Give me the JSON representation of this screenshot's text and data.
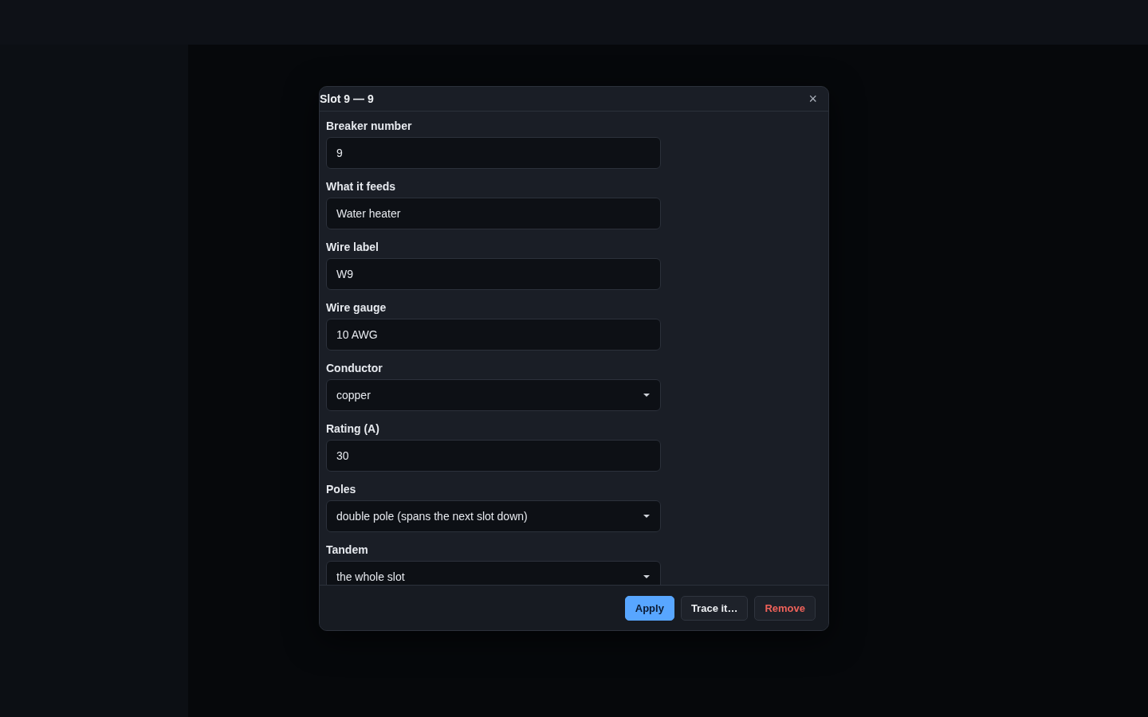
{
  "dialog": {
    "title": "Slot 9 — 9",
    "close": "×",
    "fields": [
      {
        "label": "Breaker number",
        "kind": "text",
        "value": "9"
      },
      {
        "label": "What it feeds",
        "kind": "text",
        "value": "Water heater"
      },
      {
        "label": "Wire label",
        "kind": "text",
        "value": "W9"
      },
      {
        "label": "Wire gauge",
        "kind": "text",
        "value": "10 AWG"
      },
      {
        "label": "Conductor",
        "kind": "select",
        "value": "copper"
      },
      {
        "label": "Rating (A)",
        "kind": "text",
        "value": "30"
      },
      {
        "label": "Poles",
        "kind": "select",
        "value": "double pole (spans the next slot down)"
      },
      {
        "label": "Tandem",
        "kind": "select",
        "value": "the whole slot"
      }
    ],
    "buttons": [
      {
        "label": "Apply",
        "kind": "primary"
      },
      {
        "label": "Trace it…",
        "kind": "secondary"
      },
      {
        "label": "Remove",
        "kind": "danger"
      }
    ]
  }
}
